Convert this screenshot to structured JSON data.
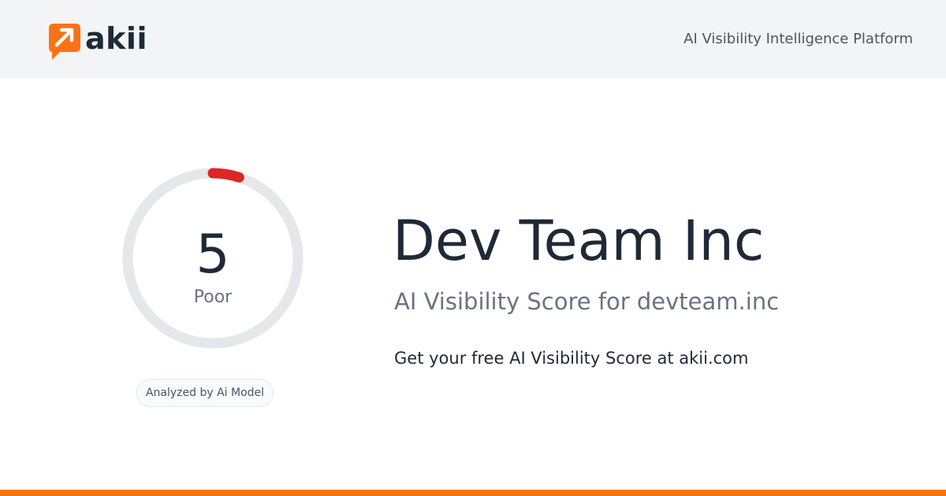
{
  "header": {
    "logo_text": "akii",
    "logo_icon": "arrow-up-right-speech-bubble-icon",
    "tagline": "AI Visibility Intelligence Platform"
  },
  "score": {
    "value": "5",
    "rating": "Poor",
    "max": 100,
    "fraction": 0.05,
    "arc_color": "#dc2626",
    "track_color": "#e5e7eb"
  },
  "badge": {
    "label": "Analyzed by Ai Model"
  },
  "main": {
    "company": "Dev Team Inc",
    "subtitle": "AI Visibility Score for devteam.inc",
    "cta": "Get your free AI Visibility Score at akii.com"
  },
  "colors": {
    "brand_orange": "#f97316",
    "header_bg": "#f3f4f6"
  }
}
